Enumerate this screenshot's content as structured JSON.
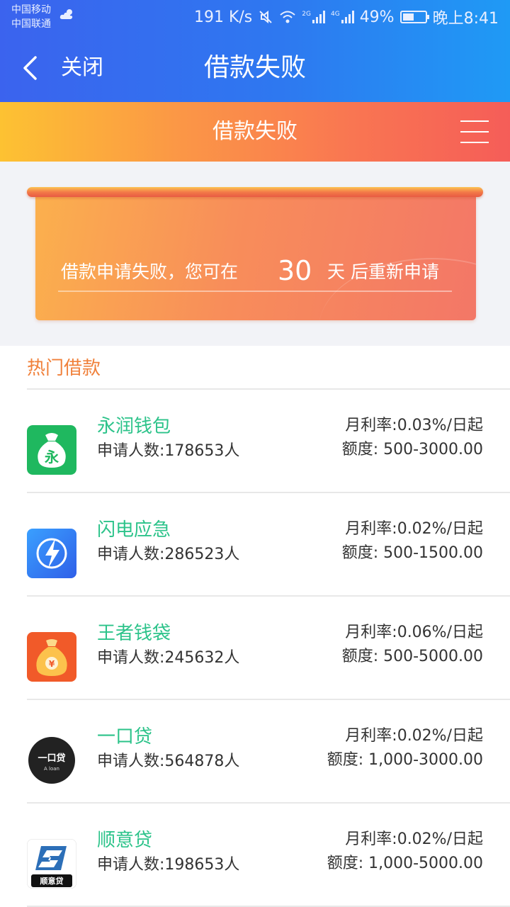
{
  "status_bar": {
    "carrier_1": "中国移动",
    "carrier_2": "中国联通",
    "speed": "191 K/s",
    "network_1": "2G",
    "network_2": "4G",
    "battery": "49%",
    "time": "晚上8:41"
  },
  "nav": {
    "close_label": "关闭",
    "title": "借款失败"
  },
  "banner": {
    "title": "借款失败"
  },
  "notice": {
    "prefix": "借款申请失败，您可在",
    "days": "30",
    "suffix": "天 后重新申请"
  },
  "hot_loans": {
    "title": "热门借款",
    "items": [
      {
        "name": "永润钱包",
        "applicants": "申请人数:178653人",
        "rate": "月利率:0.03%/日起",
        "limit": "额度: 500-3000.00",
        "icon": "wallet-bag-icon"
      },
      {
        "name": "闪电应急",
        "applicants": "申请人数:286523人",
        "rate": "月利率:0.02%/日起",
        "limit": "额度: 500-1500.00",
        "icon": "lightning-icon"
      },
      {
        "name": "王者钱袋",
        "applicants": "申请人数:245632人",
        "rate": "月利率:0.06%/日起",
        "limit": "额度: 500-5000.00",
        "icon": "money-bag-icon"
      },
      {
        "name": "一口贷",
        "applicants": "申请人数:564878人",
        "rate": "月利率:0.02%/日起",
        "limit": "额度: 1,000-3000.00",
        "icon": "yikoudai-logo-icon",
        "logo_text": "一口贷",
        "logo_sub": "A loan"
      },
      {
        "name": "顺意贷",
        "applicants": "申请人数:198653人",
        "rate": "月利率:0.02%/日起",
        "limit": "额度: 1,000-5000.00",
        "icon": "shunyidai-logo-icon",
        "logo_text": "顺意贷"
      }
    ]
  },
  "colors": {
    "nav_blue": "#2e78f0",
    "banner_orange": "#fb9746",
    "loan_name_green": "#2cc38a",
    "section_orange": "#f0803a"
  }
}
